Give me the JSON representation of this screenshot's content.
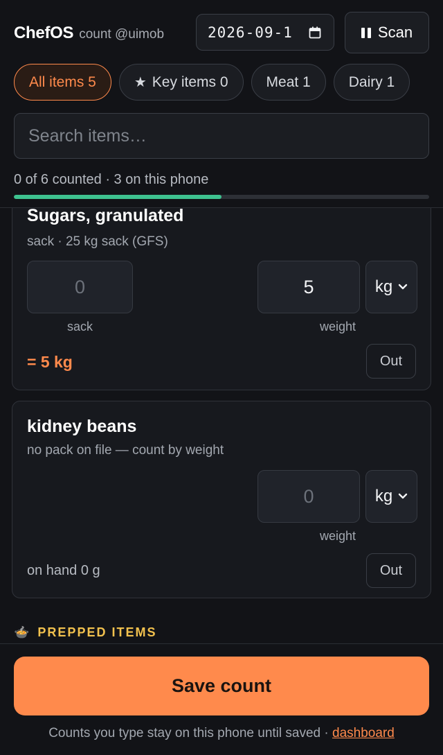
{
  "header": {
    "brand": "ChefOS",
    "subtitle": "count @uimob",
    "date_value": "2026-09-1",
    "scan_label": "Scan",
    "icons": {
      "calendar": "calendar-icon",
      "scan": "barcode-icon"
    }
  },
  "filters": [
    {
      "label": "All items 5",
      "active": true
    },
    {
      "label": "Key items 0",
      "active": false,
      "icon": "star-icon"
    },
    {
      "label": "Meat 1",
      "active": false
    },
    {
      "label": "Dairy 1",
      "active": false
    }
  ],
  "search": {
    "placeholder": "Search items…",
    "value": ""
  },
  "progress": {
    "text": "0 of 6 counted · 3 on this phone",
    "fraction": 0.5
  },
  "items": [
    {
      "name": "Sugars, granulated",
      "pack": "sack · 25 kg sack (GFS)",
      "pack_count": "0",
      "pack_label": "sack",
      "weight": "5",
      "weight_label": "weight",
      "unit": "kg",
      "total": "= 5 kg",
      "out_label": "Out"
    },
    {
      "name": "kidney beans",
      "pack": "no pack on file — count by weight",
      "weight": "0",
      "weight_label": "weight",
      "unit": "kg",
      "on_hand": "on hand 0 g",
      "out_label": "Out"
    }
  ],
  "section": {
    "title": "PREPPED ITEMS",
    "icon": "bowl-icon"
  },
  "footer": {
    "save_label": "Save count",
    "note": "Counts you type stay on this phone until saved · ",
    "link": "dashboard"
  },
  "colors": {
    "accent": "#ff8a4c",
    "progress": "#3ec28f",
    "section": "#f2c14e",
    "background": "#121317"
  }
}
